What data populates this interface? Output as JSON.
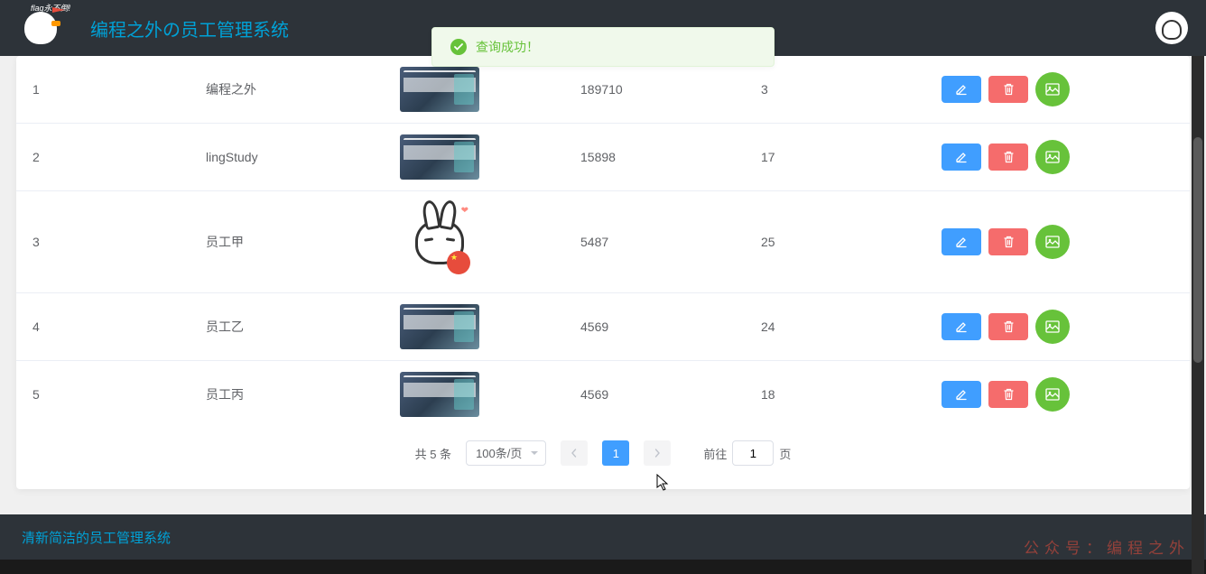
{
  "header": {
    "logo_tagline": "flag永不倒!",
    "title": "编程之外の员工管理系统"
  },
  "toast": {
    "message": "查询成功！",
    "type": "success"
  },
  "table": {
    "rows": [
      {
        "index": "1",
        "name": "编程之外",
        "image_type": "thumb",
        "number": "189710",
        "age": "3"
      },
      {
        "index": "2",
        "name": "lingStudy",
        "image_type": "thumb",
        "number": "15898",
        "age": "17"
      },
      {
        "index": "3",
        "name": "员工甲",
        "image_type": "rabbit",
        "number": "5487",
        "age": "25"
      },
      {
        "index": "4",
        "name": "员工乙",
        "image_type": "thumb",
        "number": "4569",
        "age": "24"
      },
      {
        "index": "5",
        "name": "员工丙",
        "image_type": "thumb",
        "number": "4569",
        "age": "18"
      }
    ]
  },
  "pagination": {
    "total_label": "共 5 条",
    "page_size_label": "100条/页",
    "current_page": "1",
    "jump_prefix": "前往",
    "jump_input_value": "1",
    "jump_suffix": "页"
  },
  "footer": {
    "text": "清新简洁的员工管理系统"
  },
  "watermark": "公众号：编程之外"
}
